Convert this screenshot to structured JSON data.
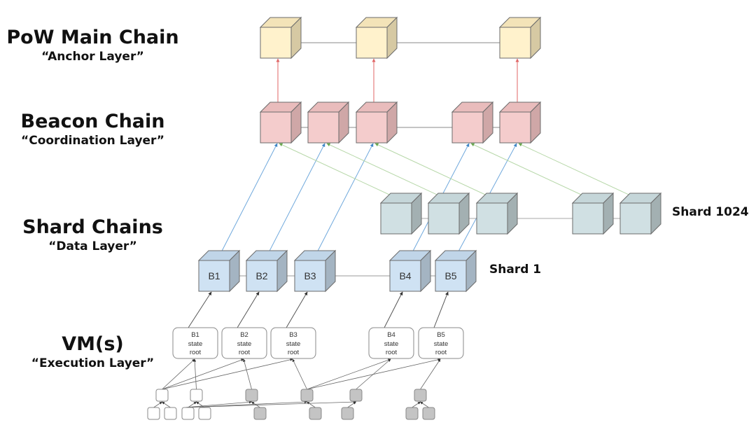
{
  "layers": [
    {
      "id": "pow",
      "title": "PoW Main Chain",
      "subtitle": "“Anchor Layer”"
    },
    {
      "id": "beacon",
      "title": "Beacon Chain",
      "subtitle": "“Coordination Layer”"
    },
    {
      "id": "shard",
      "title": "Shard Chains",
      "subtitle": "“Data Layer”"
    },
    {
      "id": "vm",
      "title": "VM(s)",
      "subtitle": "“Execution Layer”"
    }
  ],
  "shards": {
    "shard_1024_label": "Shard 1024",
    "shard_1_label": "Shard 1"
  },
  "colors": {
    "pow_front": "#fff2cc",
    "pow_top": "#f3e3b8",
    "pow_side": "#d6c9a3",
    "beacon_front": "#f4cccc",
    "beacon_top": "#e9bcbc",
    "beacon_side": "#cfa7a7",
    "shard1024_front": "#d0e0e3",
    "shard1024_top": "#c5d6d9",
    "shard1024_side": "#a3b0b2",
    "shard1_front": "#cfe2f3",
    "shard1_top": "#c0d5e8",
    "shard1_side": "#a4b4c2",
    "edge": "#6b6b6b",
    "anchor_link": "#e06666",
    "shard1_link": "#6fa8dc",
    "shard1024_link": "#b6d7a8",
    "leaf_gray": "#c4c4c4"
  },
  "pow_chain": {
    "blocks": [
      "",
      "",
      ""
    ]
  },
  "beacon_chain": {
    "blocks": [
      "",
      "",
      "",
      "",
      ""
    ]
  },
  "shard_1024": {
    "blocks": [
      "",
      "",
      "",
      "",
      ""
    ]
  },
  "shard_1": {
    "blocks": [
      "B1",
      "B2",
      "B3",
      "B4",
      "B5"
    ]
  },
  "state_roots": [
    {
      "block": "B1",
      "line1": "state",
      "line2": "root"
    },
    {
      "block": "B2",
      "line1": "state",
      "line2": "root"
    },
    {
      "block": "B3",
      "line1": "state",
      "line2": "root"
    },
    {
      "block": "B4",
      "line1": "state",
      "line2": "root"
    },
    {
      "block": "B5",
      "line1": "state",
      "line2": "root"
    }
  ]
}
